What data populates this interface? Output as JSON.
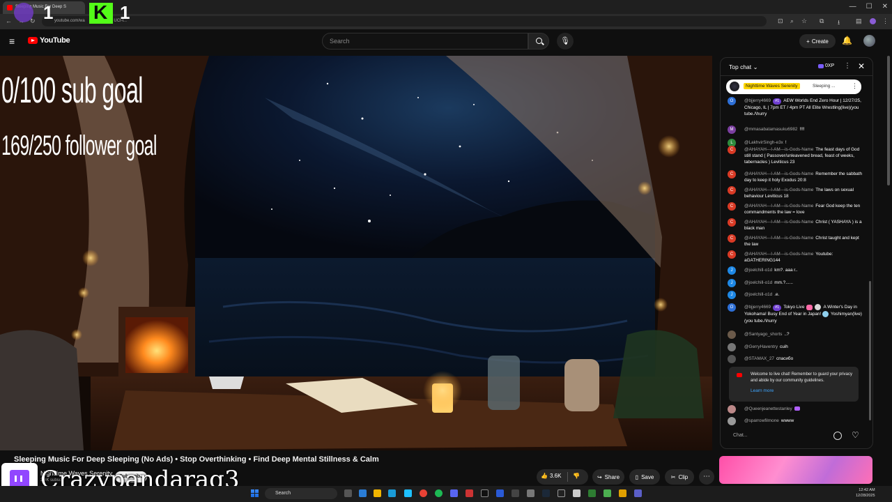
{
  "browser": {
    "tab_title": "Sleeping Music For Deep S",
    "url": "youtube.com/wa",
    "url_tail": "UCI-i..."
  },
  "header": {
    "logo_text": "YouTube",
    "search_placeholder": "Search",
    "create_label": "Create"
  },
  "stream_overlay": {
    "counter_a": "1",
    "k_badge": "K",
    "counter_b": "1",
    "sub_goal": "0/100 sub goal",
    "follower_goal": "169/250 follower goal",
    "streamer_name": "Crazypandarag3"
  },
  "video": {
    "title": "Sleeping Music For Deep Sleeping (No Ads) • Stop Overthinking • Find Deep Mental Stillness & Calm",
    "channel_name": "Nighttime Waves Serenity",
    "channel_subs": "2.9K subsc",
    "subscribe_label": "Subscribe",
    "like_count": "3.6K",
    "share_label": "Share",
    "save_label": "Save",
    "clip_label": "Clip"
  },
  "chat": {
    "mode_label": "Top chat",
    "xp_label": "0XP",
    "pinned": {
      "name": "Nighttime Waves Serenity",
      "text": "Sleeping ..."
    },
    "messages": [
      {
        "initial": "O",
        "color": "#2d6fd6",
        "author": "@bjjerry4669",
        "badge": "#1",
        "text": "AEW Worlds End Zero Hour | 12/27/25, Chicago, IL | 7pm ET / 4pm PT All Elite Wrestling(live)(you tube./\\hurry"
      },
      {
        "initial": "M",
        "color": "#7b3fa0",
        "author": "@mmasabatamasuku6982",
        "text": "!!!!"
      },
      {
        "initial": "L",
        "color": "#2e8b3d",
        "author": "@LakhvirSingh-e3x",
        "text": "!"
      },
      {
        "initial": "C",
        "color": "#d93a25",
        "author": "@AHAYAH---I-AM---is-Gods-Name",
        "text": "The feast days of God still stand ( Passover/unleavened bread, feast of weeks, tabernacles ) Leviticus 23"
      },
      {
        "initial": "C",
        "color": "#d93a25",
        "author": "@AHAYAH---I-AM---is-Gods-Name",
        "text": "Remember the sabbath day to keep it holy Exodus 20:8"
      },
      {
        "initial": "C",
        "color": "#d93a25",
        "author": "@AHAYAH---I-AM---is-Gods-Name",
        "text": "The laws on sexual behaviour Leviticus 18"
      },
      {
        "initial": "C",
        "color": "#d93a25",
        "author": "@AHAYAH---I-AM---is-Gods-Name",
        "text": "Fear God keep the ten commandments the law = love"
      },
      {
        "initial": "C",
        "color": "#d93a25",
        "author": "@AHAYAH---I-AM---is-Gods-Name",
        "text": "Christ ( YASHAYA ) is a black man"
      },
      {
        "initial": "C",
        "color": "#d93a25",
        "author": "@AHAYAH---I-AM---is-Gods-Name",
        "text": "Christ taught and kept the law"
      },
      {
        "initial": "C",
        "color": "#d93a25",
        "author": "@AHAYAH---I-AM---is-Gods-Name",
        "text": "Youtube: aGATHERING144"
      },
      {
        "initial": "J",
        "color": "#1e88e5",
        "author": "@joelchill-o1d",
        "text": "km?. aaa r.."
      },
      {
        "initial": "J",
        "color": "#1e88e5",
        "author": "@joelchill-o1d",
        "text": "mm.?......"
      },
      {
        "initial": "J",
        "color": "#1e88e5",
        "author": "@joelchill-o1d",
        "text": ".e."
      },
      {
        "initial": "O",
        "color": "#2d6fd6",
        "author": "@bjjerry4669",
        "badge": "#1",
        "text": "Tokyo Live",
        "emojis": true,
        "text2": "A Winter's Day in Yokohama! Busy End of Year in Japan!",
        "text3": "Yoshimyan(live)(you tube./\\hurry"
      },
      {
        "initial": "",
        "color": "#6b5a4a",
        "author": "@Santyago_shorts",
        "text": "..?"
      },
      {
        "initial": "",
        "color": "#777",
        "author": "@GerryHaventry",
        "text": "cuih"
      },
      {
        "initial": "",
        "color": "#555",
        "author": "@STAMAX_27",
        "text": "спасибо"
      }
    ],
    "notice_text": "Welcome to live chat! Remember to guard your privacy and abide by our community guidelines.",
    "notice_link": "Learn more",
    "messages_after": [
      {
        "initial": "",
        "color": "#b88",
        "author": "@Queenjeanettestanley",
        "text": ""
      },
      {
        "initial": "",
        "color": "#999",
        "author": "@sparrowfilmone",
        "text": "wwww"
      }
    ],
    "input_placeholder": "Chat..."
  },
  "taskbar": {
    "search_label": "Search",
    "time": "12:42 AM",
    "date": "12/28/2025"
  }
}
